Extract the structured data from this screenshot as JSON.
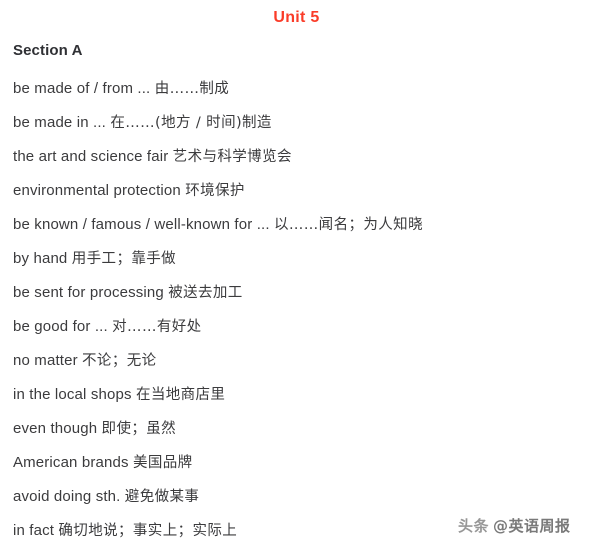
{
  "document": {
    "title": "Unit 5",
    "title_color": "#fa3c28",
    "section_heading": "Section A",
    "background_color": "#ffffff",
    "text_color": "#3b3b3d"
  },
  "entries": [
    {
      "en": "be made of / from ... ",
      "zh": "由……制成"
    },
    {
      "en": "be made in ... ",
      "zh": "在……(地方 / 时间)制造"
    },
    {
      "en": "the art and science fair ",
      "zh": "艺术与科学博览会"
    },
    {
      "en": "environmental protection ",
      "zh": "环境保护"
    },
    {
      "en": "be known  / famous  / well-known for ... ",
      "zh": "以……闻名；为人知晓"
    },
    {
      "en": "by hand ",
      "zh": "用手工；靠手做"
    },
    {
      "en": "be sent for processing ",
      "zh": "被送去加工"
    },
    {
      "en": "be good for ... ",
      "zh": "对……有好处"
    },
    {
      "en": "no matter ",
      "zh": "不论；无论"
    },
    {
      "en": "in the local shops ",
      "zh": "在当地商店里"
    },
    {
      "en": "even though ",
      "zh": "即使；虽然"
    },
    {
      "en": "American brands ",
      "zh": "美国品牌"
    },
    {
      "en": "avoid doing sth. ",
      "zh": "避免做某事"
    },
    {
      "en": "in fact ",
      "zh": "确切地说；事实上；实际上"
    }
  ],
  "watermark": {
    "brand": "头条",
    "handle": "@英语周报"
  }
}
